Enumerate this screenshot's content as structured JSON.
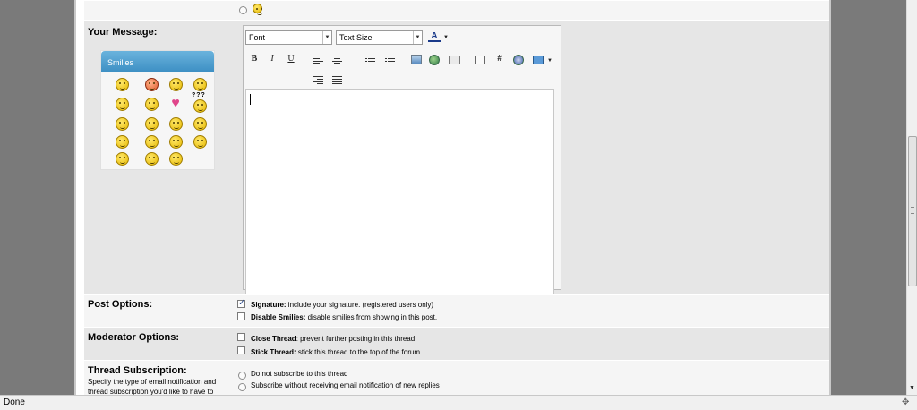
{
  "form": {
    "message_label": "Your Message:",
    "smilies_title": "Smilies",
    "font_select": "Font",
    "size_select": "Text Size",
    "post_options_label": "Post Options:",
    "signature_bold": "Signature:",
    "signature_text": "include your signature. (registered users only)",
    "signature_checked": true,
    "disable_smilies_bold": "Disable Smilies:",
    "disable_smilies_text": "disable smilies from showing in this post.",
    "moderator_label": "Moderator Options:",
    "close_thread_bold": "Close Thread",
    "close_thread_text": ": prevent further posting in this thread.",
    "stick_thread_bold": "Stick Thread:",
    "stick_thread_text": "stick this thread to the top of the forum.",
    "subscription_label": "Thread Subscription:",
    "subscription_desc": "Specify the type of email notification and thread subscription you'd like to have to",
    "sub_options": [
      "Do not subscribe to this thread",
      "Subscribe without receiving email notification of new replies"
    ]
  },
  "toolbar": {
    "bold": "B",
    "italic": "I",
    "underline": "U",
    "hash": "#"
  },
  "smilies": {
    "icons": [
      "confused-icon",
      "mad-icon",
      "smile-icon",
      "frown-icon",
      "cool-icon",
      "exclamation-icon",
      "heart-icon",
      "question-icon",
      "idea-icon",
      "wink-icon",
      "eek-icon",
      "biggrin-icon",
      "tongue-icon",
      "redface-icon",
      "grin-icon",
      "laugh-icon",
      "rolleyes-icon",
      "blush-icon"
    ],
    "heart_glyph": "♥",
    "question_glyph": "???"
  },
  "status": {
    "text": "Done"
  },
  "colors": {
    "page_gutter": "#7a7a7a",
    "row_light": "#f5f5f5",
    "row_dark": "#e6e6e6",
    "smilies_header": "#3e90c4"
  }
}
